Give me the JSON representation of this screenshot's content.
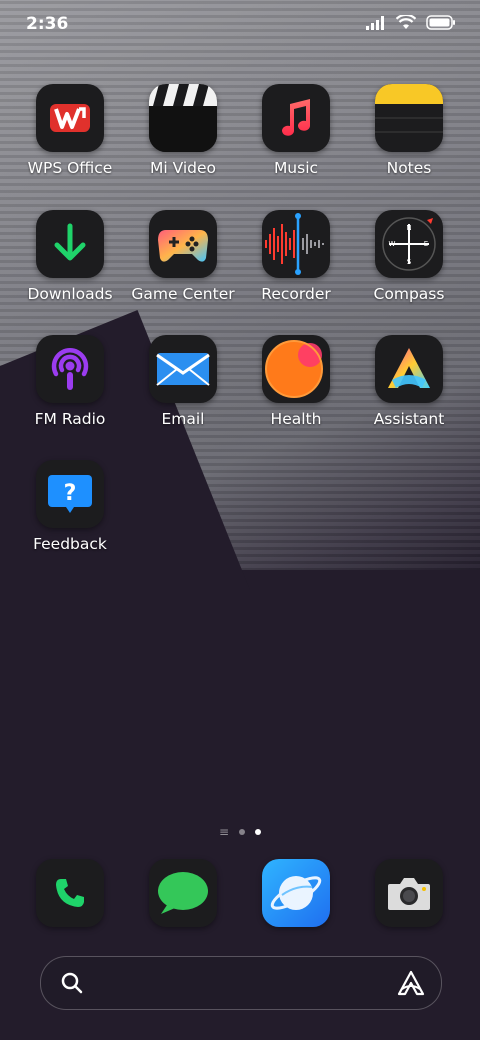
{
  "status_bar": {
    "time": "2:36"
  },
  "apps": [
    {
      "label": "WPS Office",
      "icon": "wps-office-icon"
    },
    {
      "label": "Mi Video",
      "icon": "mi-video-icon"
    },
    {
      "label": "Music",
      "icon": "music-icon"
    },
    {
      "label": "Notes",
      "icon": "notes-icon"
    },
    {
      "label": "Downloads",
      "icon": "downloads-icon"
    },
    {
      "label": "Game Center",
      "icon": "game-center-icon"
    },
    {
      "label": "Recorder",
      "icon": "recorder-icon"
    },
    {
      "label": "Compass",
      "icon": "compass-icon"
    },
    {
      "label": "FM Radio",
      "icon": "fm-radio-icon"
    },
    {
      "label": "Email",
      "icon": "email-icon"
    },
    {
      "label": "Health",
      "icon": "health-icon"
    },
    {
      "label": "Assistant",
      "icon": "assistant-icon"
    },
    {
      "label": "Feedback",
      "icon": "feedback-icon"
    }
  ],
  "compass_letters": {
    "n": "N",
    "s": "S",
    "e": "E",
    "w": "W"
  },
  "dock": [
    {
      "icon": "phone-icon"
    },
    {
      "icon": "messages-icon"
    },
    {
      "icon": "browser-icon"
    },
    {
      "icon": "camera-icon"
    }
  ],
  "page_indicator": {
    "pages": 2,
    "current": 2
  },
  "colors": {
    "accent_green": "#1fd36a",
    "wps_red": "#e0312c",
    "notes_yellow": "#f8c826",
    "email_blue": "#2b8ff0"
  }
}
